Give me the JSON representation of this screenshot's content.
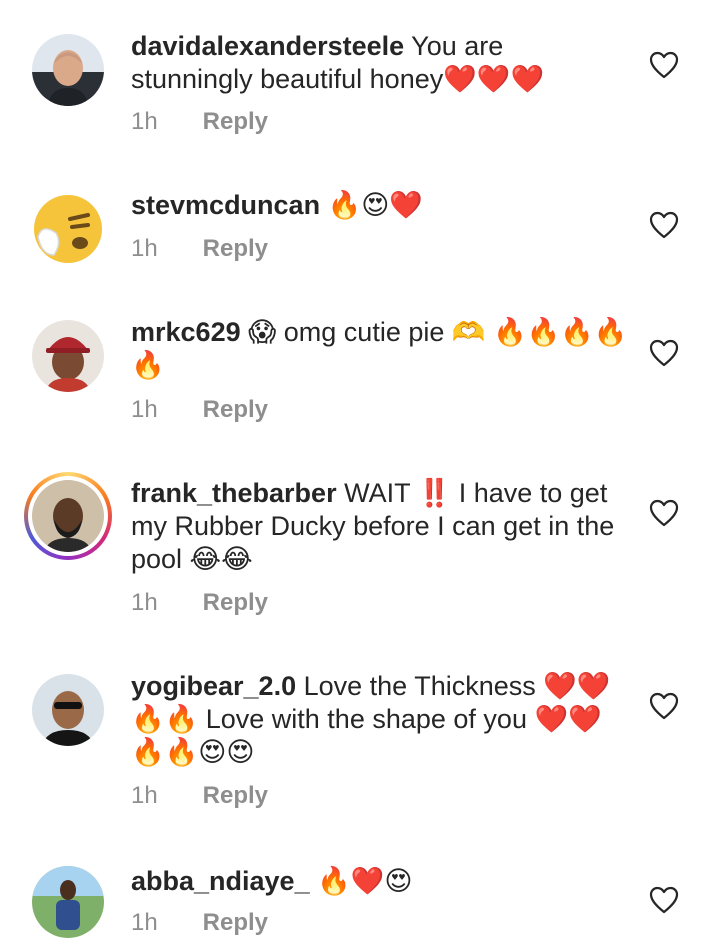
{
  "comments": [
    {
      "username": "davidalexandersteele",
      "text": "You are stunningly beautiful honey❤️❤️❤️",
      "time": "1h",
      "reply": "Reply"
    },
    {
      "username": "stevmcduncan",
      "text": "🔥😍❤️",
      "time": "1h",
      "reply": "Reply"
    },
    {
      "username": "mrkc629",
      "text": "😱 omg cutie pie 🫶 🔥🔥🔥🔥🔥",
      "time": "1h",
      "reply": "Reply"
    },
    {
      "username": "frank_thebarber",
      "text": "WAIT ‼️ I have to get my Rubber Ducky before I can get in the pool 😂😂",
      "time": "1h",
      "reply": "Reply"
    },
    {
      "username": "yogibear_2.0",
      "text": "Love the Thickness ❤️❤️🔥🔥 Love with the shape of you ❤️❤️🔥🔥😍😍",
      "time": "1h",
      "reply": "Reply"
    },
    {
      "username": "abba_ndiaye_",
      "text": "🔥❤️😍",
      "time": "1h",
      "reply": "Reply"
    }
  ],
  "icons": {
    "like": "heart-outline-icon"
  },
  "colors": {
    "text": "#262626",
    "muted": "#8e8e8e",
    "background": "#ffffff"
  }
}
